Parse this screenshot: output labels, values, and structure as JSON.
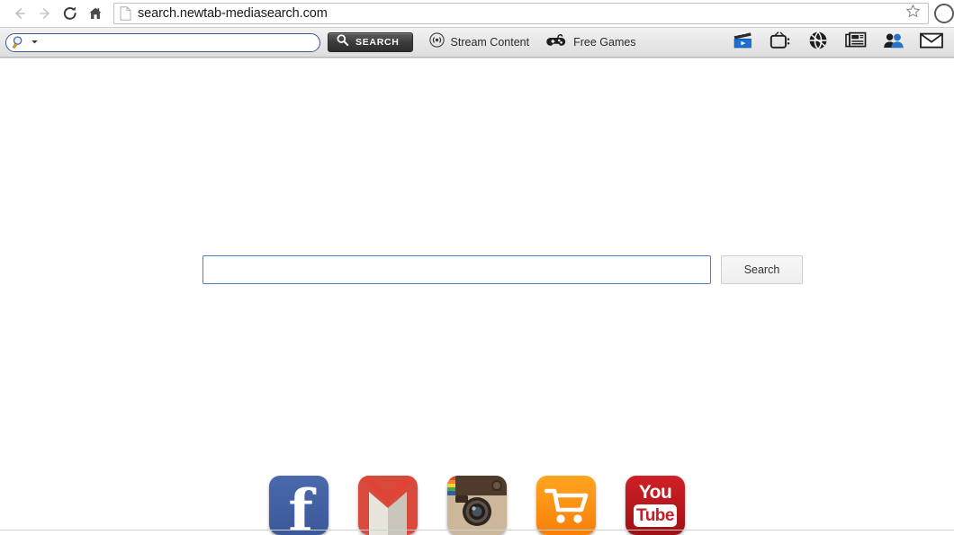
{
  "browser": {
    "back_icon": "back-arrow-icon",
    "forward_icon": "forward-arrow-icon",
    "reload_icon": "reload-icon",
    "home_icon": "home-icon",
    "page_icon": "page-document-icon",
    "url": "search.newtab-mediasearch.com",
    "bookmark_icon": "star-icon",
    "profile_icon": "profile-avatar-icon"
  },
  "toolbar": {
    "search_field": {
      "value": "",
      "placeholder": "",
      "magnifier_icon": "magnifier-icon",
      "dropdown_icon": "chevron-down-icon"
    },
    "search_button": {
      "label": "SEARCH",
      "icon": "magnifier-icon"
    },
    "links": [
      {
        "label": "Stream Content",
        "icon": "broadcast-signal-icon"
      },
      {
        "label": "Free Games",
        "icon": "gamepad-icon"
      }
    ],
    "icons": [
      {
        "name": "movie-clapperboard-icon",
        "title": "Movies"
      },
      {
        "name": "television-icon",
        "title": "TV"
      },
      {
        "name": "basketball-icon",
        "title": "Sports"
      },
      {
        "name": "newspaper-icon",
        "title": "News"
      },
      {
        "name": "contacts-people-icon",
        "title": "Social"
      },
      {
        "name": "envelope-mail-icon",
        "title": "Mail"
      }
    ]
  },
  "main": {
    "search_input": {
      "value": "",
      "placeholder": ""
    },
    "search_button_label": "Search",
    "shortcuts": [
      {
        "name": "facebook",
        "label": "f"
      },
      {
        "name": "gmail",
        "label": "M"
      },
      {
        "name": "instagram",
        "label": ""
      },
      {
        "name": "shopping-cart",
        "label": ""
      },
      {
        "name": "youtube",
        "label_top": "You",
        "label_bottom": "Tube"
      }
    ]
  },
  "colors": {
    "facebook": "#3b5998",
    "gmail_red": "#d93025",
    "instagram_tan": "#c9b79c",
    "cart_orange": "#f97f08",
    "youtube_red": "#c22027",
    "accent_blue": "#4a80c8"
  }
}
